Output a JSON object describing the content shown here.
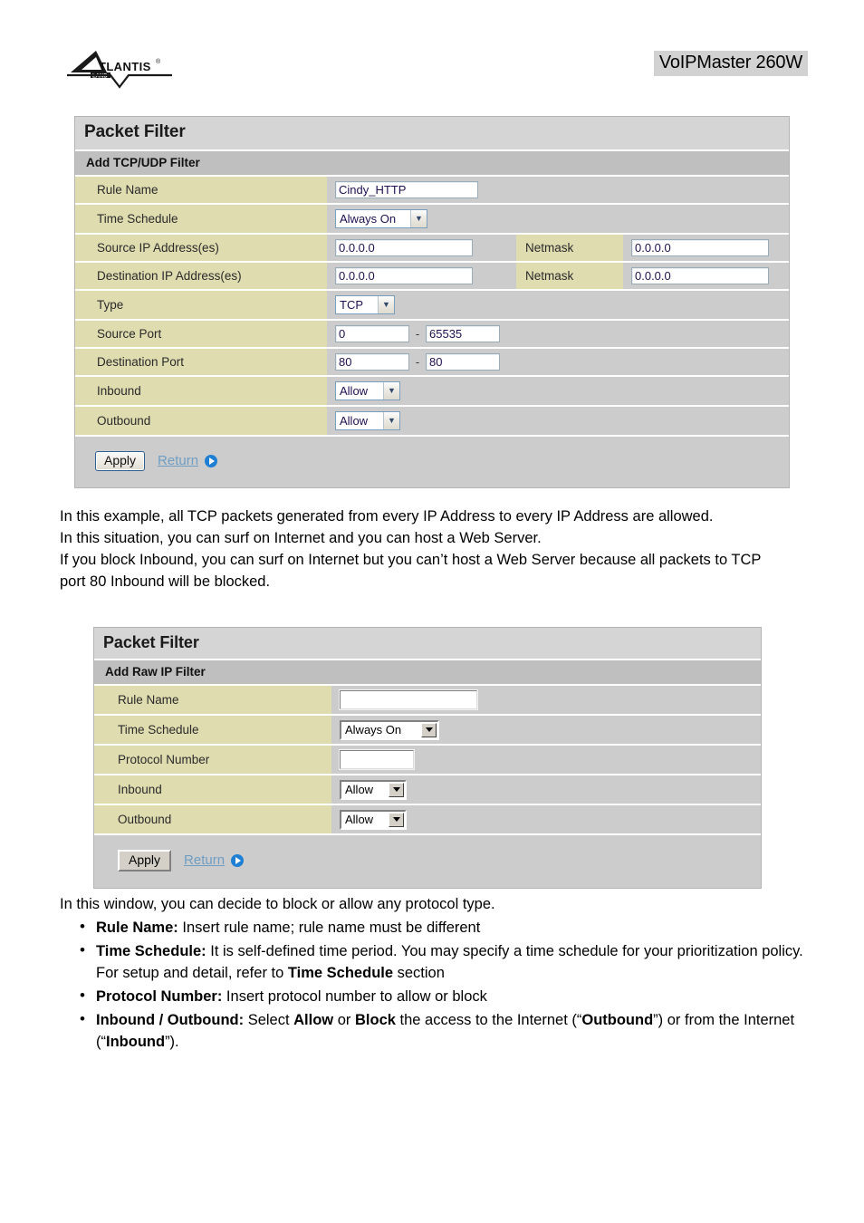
{
  "header": {
    "logo_main": "ATLANTIS",
    "logo_sub": "LAND",
    "logo_reg": "®",
    "doc_title": "VoIPMaster 260W"
  },
  "panel1": {
    "title": "Packet Filter",
    "subtitle": "Add TCP/UDP Filter",
    "rows": {
      "rule_name_label": "Rule Name",
      "rule_name_value": "Cindy_HTTP",
      "time_schedule_label": "Time Schedule",
      "time_schedule_value": "Always On",
      "source_ip_label": "Source IP Address(es)",
      "source_ip_value": "0.0.0.0",
      "source_netmask_label": "Netmask",
      "source_netmask_value": "0.0.0.0",
      "dest_ip_label": "Destination IP Address(es)",
      "dest_ip_value": "0.0.0.0",
      "dest_netmask_label": "Netmask",
      "dest_netmask_value": "0.0.0.0",
      "type_label": "Type",
      "type_value": "TCP",
      "source_port_label": "Source Port",
      "source_port_from": "0",
      "source_port_to": "65535",
      "port_separator": "-",
      "dest_port_label": "Destination Port",
      "dest_port_from": "80",
      "dest_port_to": "80",
      "inbound_label": "Inbound",
      "inbound_value": "Allow",
      "outbound_label": "Outbound",
      "outbound_value": "Allow"
    },
    "apply_label": "Apply",
    "return_label": "Return"
  },
  "panel2": {
    "title": "Packet Filter",
    "subtitle": "Add Raw IP Filter",
    "rows": {
      "rule_name_label": "Rule Name",
      "rule_name_value": "",
      "time_schedule_label": "Time Schedule",
      "time_schedule_value": "Always On",
      "protocol_number_label": "Protocol Number",
      "protocol_number_value": "",
      "inbound_label": "Inbound",
      "inbound_value": "Allow",
      "outbound_label": "Outbound",
      "outbound_value": "Allow"
    },
    "apply_label": "Apply",
    "return_label": "Return"
  },
  "paragraph1": {
    "line1": "In this example, all TCP packets generated from every IP Address to every IP Address are allowed.",
    "line2": "In this situation, you can surf on Internet and you can host a Web Server.",
    "line3": "If you block Inbound, you can surf on Internet but you can’t host a Web Server because all packets to TCP port 80 Inbound will be blocked."
  },
  "paragraph2": {
    "intro": "In this window, you can decide to block or allow any protocol type.",
    "bullets": [
      {
        "term": "Rule Name:",
        "text_1": " Insert rule name; rule name must be different"
      },
      {
        "term": "Time Schedule:",
        "text_1": " It is self-defined time period. You may specify a time schedule for your prioritization policy. For setup and detail, refer to ",
        "strong_1": "Time Schedule",
        "text_2": " section"
      },
      {
        "term": "Protocol Number:",
        "text_1": " Insert protocol number to allow or block"
      },
      {
        "term": "Inbound / Outbound:",
        "text_1": " Select ",
        "strong_1": "Allow",
        "text_2": " or ",
        "strong_2": "Block",
        "text_3": " the access to the Internet (“",
        "strong_3": "Outbound",
        "text_4": "”) or from the Internet (“",
        "strong_4": "Inbound",
        "text_5": "”)."
      }
    ]
  },
  "colors": {
    "panel_bg": "#cccccc",
    "label_bg": "#dfdcb0",
    "title_bg": "#d5d5d5",
    "subtitle_bg": "#bfbfbf",
    "link": "#6f9dc4",
    "doc_title_bg": "#d2d2d2"
  }
}
